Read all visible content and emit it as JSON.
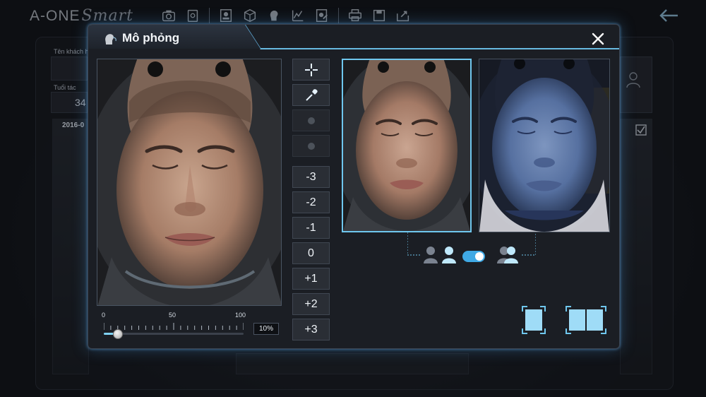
{
  "app": {
    "brand": "A-ONE",
    "brand_script": "Smart"
  },
  "background": {
    "customer_name_label": "Tên khách h",
    "age_label": "Tuổi tác",
    "age_value": "34",
    "date_label": "2016-0"
  },
  "modal": {
    "title": "Mô phỏng",
    "tools": {
      "crosshair_label": "crosshair",
      "picker_label": "color-picker",
      "levels": [
        "-3",
        "-2",
        "-1",
        "0",
        "+1",
        "+2",
        "+3"
      ]
    },
    "slider": {
      "min_label": "0",
      "mid_label": "50",
      "max_label": "100",
      "value": 10,
      "value_text": "10%"
    },
    "compare": {
      "toggle_on": true
    },
    "colors": {
      "accent": "#6fc7ee",
      "toggle": "#3fa9e5",
      "panel": "#1b1e24"
    }
  }
}
